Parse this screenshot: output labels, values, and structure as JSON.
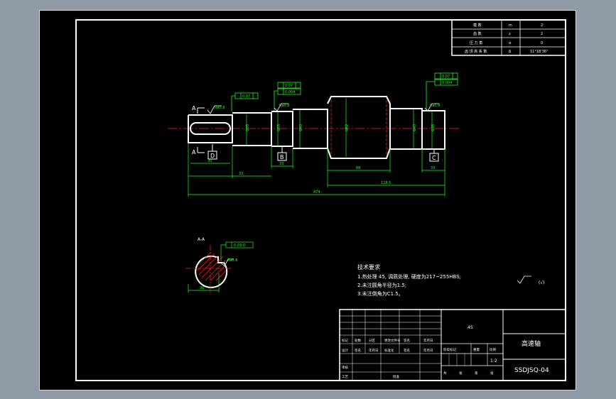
{
  "params": {
    "rows": [
      {
        "name": "模 数",
        "sym": "m",
        "val": "2"
      },
      {
        "name": "齿 数",
        "sym": "z",
        "val": "2"
      },
      {
        "name": "压 力 角",
        "sym": "α",
        "val": "0"
      },
      {
        "name": "齿 顶 高 系 数",
        "sym": "β",
        "val": "11°18'36\""
      }
    ]
  },
  "dims": {
    "d1": "30",
    "d2": "33",
    "d3": "33",
    "d4": "88",
    "d5": "128.5",
    "d6": "474",
    "dia1": "Φ35",
    "dia2": "Φ35",
    "dia3": "Φ40",
    "dia4": "Φ52",
    "dia5": "Φ58",
    "dia6": "Φ40",
    "dia7": "Φ35",
    "runout1": "0.07",
    "runout2": "0.07",
    "flat1": "0.004",
    "flat2": "0.004",
    "rough": "Ra0.8",
    "section_dim": "30",
    "sym_tol": "0.03 D"
  },
  "datums": {
    "d": "D",
    "b": "B",
    "c": "C"
  },
  "section": {
    "label_a1": "A",
    "label_a2": "A",
    "title": "A-A"
  },
  "tech": {
    "title": "技术要求",
    "line1": "1.热处理 45, 调质处理, 硬度为217~255HBS;",
    "line2": "2.未注圆角半径为1.5;",
    "line3": "3.未注倒角为C1.5。"
  },
  "rough_note": "(√)",
  "title_block": {
    "part_name": "高速轴",
    "drawing_no": "SSDJSQ-04",
    "material": "45",
    "scale": "1:2",
    "cells": {
      "c1": "标记",
      "c2": "处数",
      "c3": "分区",
      "c4": "更改文件号",
      "c5": "签名",
      "c6": "年月日",
      "c7": "设计",
      "c8": "签名",
      "c9": "年月日",
      "c10": "标准化",
      "c11": "签名",
      "c12": "年月日",
      "c13": "阶段标记",
      "c14": "重量",
      "c15": "比例",
      "c16": "审核",
      "c17": "工艺",
      "c18": "批准",
      "c19": "共",
      "c20": "张",
      "c21": "第",
      "c22": "张"
    }
  }
}
